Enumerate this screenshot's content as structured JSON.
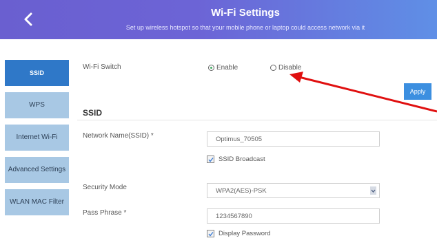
{
  "header": {
    "title": "Wi-Fi Settings",
    "subtitle": "Set up wireless hotspot so that your mobile phone or laptop could access network via it",
    "back_icon": "chevron-left-icon"
  },
  "sidebar": {
    "items": [
      {
        "label": "SSID",
        "active": true
      },
      {
        "label": "WPS",
        "active": false
      },
      {
        "label": "Internet Wi-Fi",
        "active": false
      },
      {
        "label": "Advanced Settings",
        "active": false
      },
      {
        "label": "WLAN MAC Filter",
        "active": false
      }
    ]
  },
  "wifi_switch": {
    "label": "Wi-Fi Switch",
    "enable_label": "Enable",
    "disable_label": "Disable",
    "selected": "Enable"
  },
  "apply_label": "Apply",
  "section_title": "SSID",
  "network_name": {
    "label": "Network Name(SSID) *",
    "value": "Optimus_70505"
  },
  "ssid_broadcast": {
    "label": "SSID Broadcast",
    "checked": true
  },
  "security_mode": {
    "label": "Security Mode",
    "value": "WPA2(AES)-PSK"
  },
  "pass_phrase": {
    "label": "Pass Phrase *",
    "value": "1234567890"
  },
  "display_password": {
    "label": "Display Password",
    "checked": true
  },
  "colors": {
    "header_start": "#6a5fd0",
    "header_end": "#5f8fe6",
    "nav_active": "#2f78c8",
    "nav_inactive": "#a8c8e4",
    "apply": "#3c8fe0",
    "annotation_arrow": "#e01010"
  }
}
